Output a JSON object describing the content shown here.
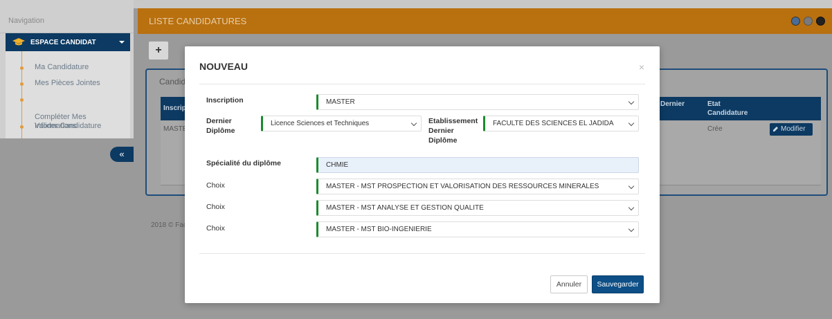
{
  "sidebar": {
    "nav_label": "Navigation",
    "espace_label": "ESPACE CANDIDAT",
    "items": [
      {
        "label": "Ma Candidature"
      },
      {
        "label": "Mes Pièces Jointes"
      },
      {
        "label": "Compléter Mes\nInformations"
      },
      {
        "label": "Valider Candidature"
      }
    ],
    "collapse_icon": "«"
  },
  "header": {
    "title": "LISTE CANDIDATURES"
  },
  "toolbar": {
    "add_label": "+"
  },
  "panel": {
    "title": "Candid",
    "columns": [
      "Inscrip",
      "Dernier",
      "Etat\nCandidature"
    ],
    "row": {
      "inscription": "MASTE",
      "etat": "Crée",
      "action_label": "Modifier"
    }
  },
  "footer": {
    "text": "2018 © Fac"
  },
  "modal": {
    "title": "NOUVEAU",
    "close": "×",
    "inscription_label": "Inscription",
    "inscription_value": "MASTER",
    "dernier_diplome_label": "Dernier\nDiplôme",
    "dernier_diplome_value": "Licence Sciences et Techniques",
    "etablissement_label": "Etablissement\nDernier\nDiplôme",
    "etablissement_value": "FACULTE DES SCIENCES EL JADIDA",
    "specialite_label": "Spécialité du diplôme",
    "specialite_value": "CHMIE",
    "choix": [
      {
        "label": "Choix",
        "value": "MASTER - MST PROSPECTION ET VALORISATION DES RESSOURCES MINERALES"
      },
      {
        "label": "Choix",
        "value": "MASTER - MST ANALYSE ET GESTION QUALITE"
      },
      {
        "label": "Choix",
        "value": "MASTER - MST BIO-INGENIERIE"
      }
    ],
    "cancel_label": "Annuler",
    "save_label": "Sauvegarder"
  },
  "colors": {
    "header": "#b9700f",
    "navy": "#0c3a62",
    "accent_green": "#1a8a2e",
    "submenu_orange": "#e09a3e",
    "save_button": "#0d4f86"
  }
}
